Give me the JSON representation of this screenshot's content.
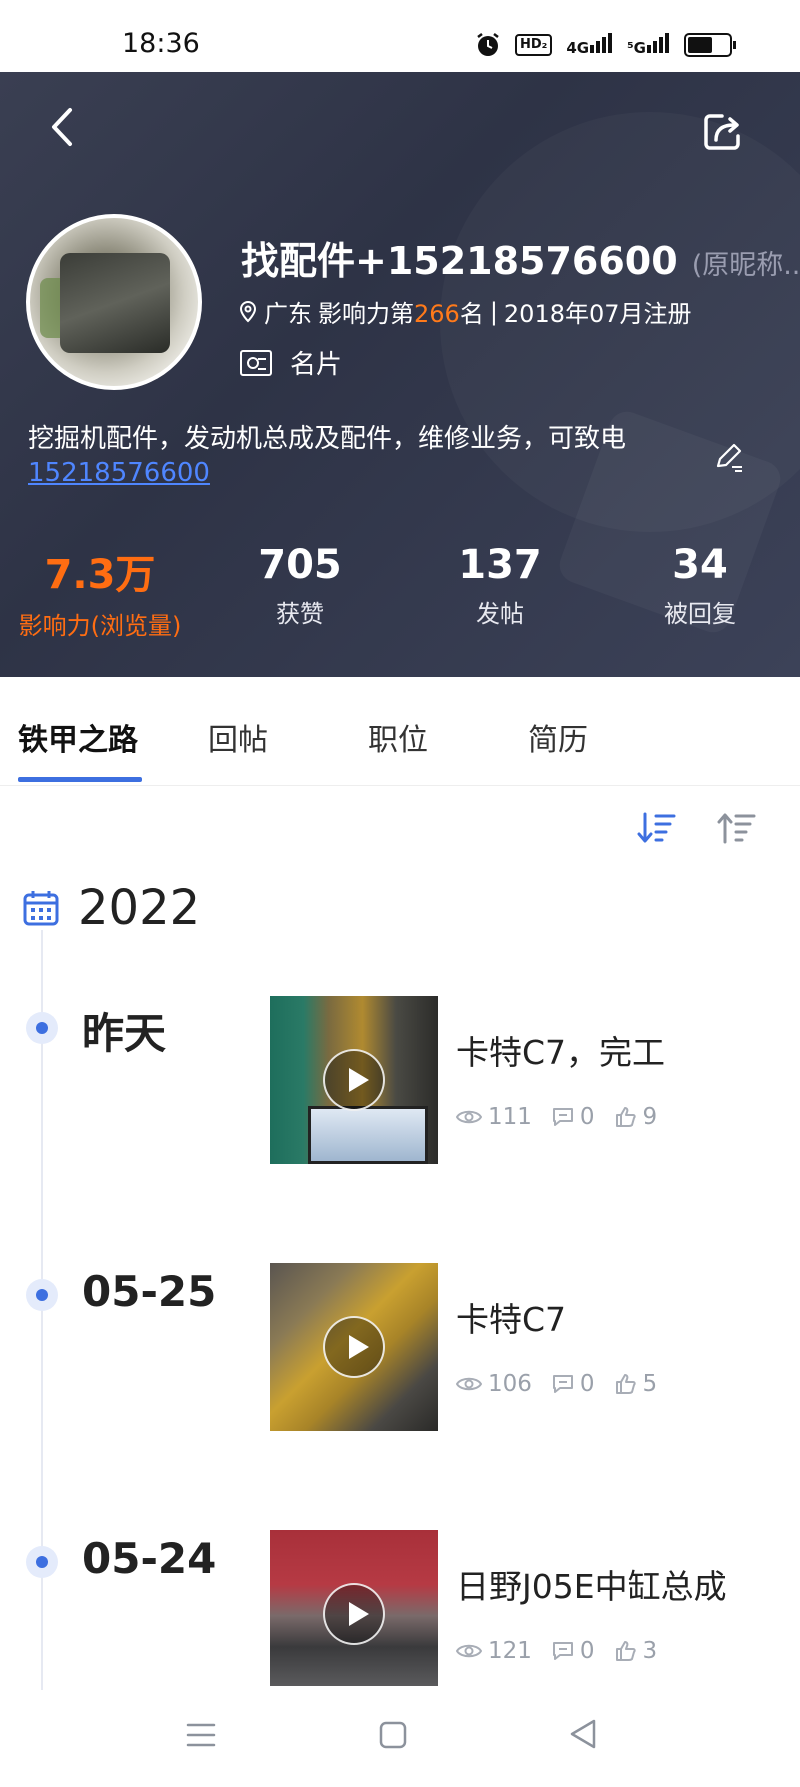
{
  "status_bar": {
    "time": "18:36",
    "hd": "HD₂",
    "net1": "4G",
    "net2": "⁵G"
  },
  "profile": {
    "name": "找配件+15218576600",
    "original_name": "(原昵称...",
    "location": "广东",
    "influence_prefix": "影响力第",
    "influence_rank": "266",
    "influence_suffix": "名",
    "separator": "|",
    "registered": "2018年07月注册",
    "card_label": "名片",
    "bio_text": "挖掘机配件，发动机总成及配件，维修业务，可致电",
    "bio_phone": "15218576600"
  },
  "stats": [
    {
      "value": "7.3万",
      "label": "影响力(浏览量)"
    },
    {
      "value": "705",
      "label": "获赞"
    },
    {
      "value": "137",
      "label": "发帖"
    },
    {
      "value": "34",
      "label": "被回复"
    }
  ],
  "tabs": [
    "铁甲之路",
    "回帖",
    "职位",
    "简历"
  ],
  "timeline": {
    "year": "2022",
    "entries": [
      {
        "date": "昨天",
        "title": "卡特C7，完工",
        "views": "111",
        "comments": "0",
        "likes": "9"
      },
      {
        "date": "05-25",
        "title": "卡特C7",
        "views": "106",
        "comments": "0",
        "likes": "5"
      },
      {
        "date": "05-24",
        "title": "日野J05E中缸总成",
        "views": "121",
        "comments": "0",
        "likes": "3"
      }
    ]
  },
  "colors": {
    "accent": "#3d6fe0",
    "highlight": "#ff6d12",
    "header_bg": "#2e3346"
  }
}
